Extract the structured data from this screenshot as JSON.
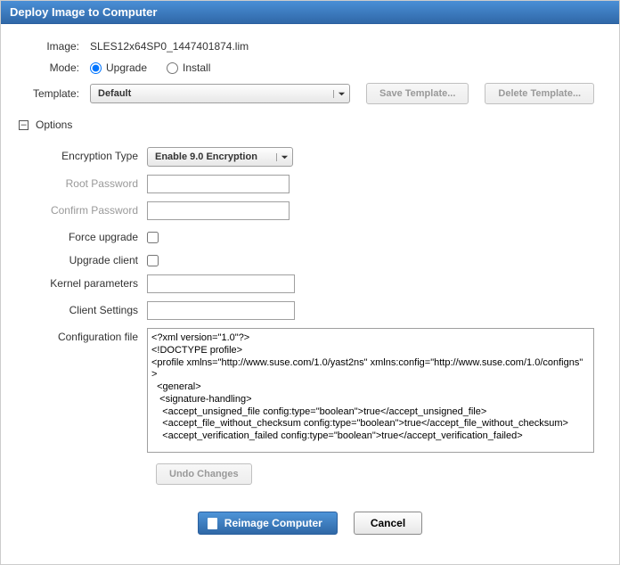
{
  "title": "Deploy Image to Computer",
  "labels": {
    "image": "Image:",
    "mode": "Mode:",
    "template": "Template:"
  },
  "image_value": "SLES12x64SP0_1447401874.lim",
  "mode": {
    "upgrade": "Upgrade",
    "install": "Install",
    "selected": "upgrade"
  },
  "template": {
    "selected": "Default"
  },
  "buttons": {
    "save_template": "Save Template...",
    "delete_template": "Delete Template...",
    "undo": "Undo Changes",
    "reimage": "Reimage Computer",
    "cancel": "Cancel"
  },
  "options_header": "Options",
  "toggle_symbol": "–",
  "options": {
    "encryption_type": {
      "label": "Encryption Type",
      "selected": "Enable 9.0 Encryption"
    },
    "root_password": {
      "label": "Root Password",
      "value": ""
    },
    "confirm_password": {
      "label": "Confirm Password",
      "value": ""
    },
    "force_upgrade": {
      "label": "Force upgrade",
      "checked": false
    },
    "upgrade_client": {
      "label": "Upgrade client",
      "checked": false
    },
    "kernel_parameters": {
      "label": "Kernel parameters",
      "value": ""
    },
    "client_settings": {
      "label": "Client Settings",
      "value": ""
    },
    "configuration_file": {
      "label": "Configuration file",
      "value": "<?xml version=\"1.0\"?>\n<!DOCTYPE profile>\n<profile xmlns=\"http://www.suse.com/1.0/yast2ns\" xmlns:config=\"http://www.suse.com/1.0/configns\" >\n  <general>\n   <signature-handling>\n    <accept_unsigned_file config:type=\"boolean\">true</accept_unsigned_file>\n    <accept_file_without_checksum config:type=\"boolean\">true</accept_file_without_checksum>\n    <accept_verification_failed config:type=\"boolean\">true</accept_verification_failed>"
    }
  }
}
